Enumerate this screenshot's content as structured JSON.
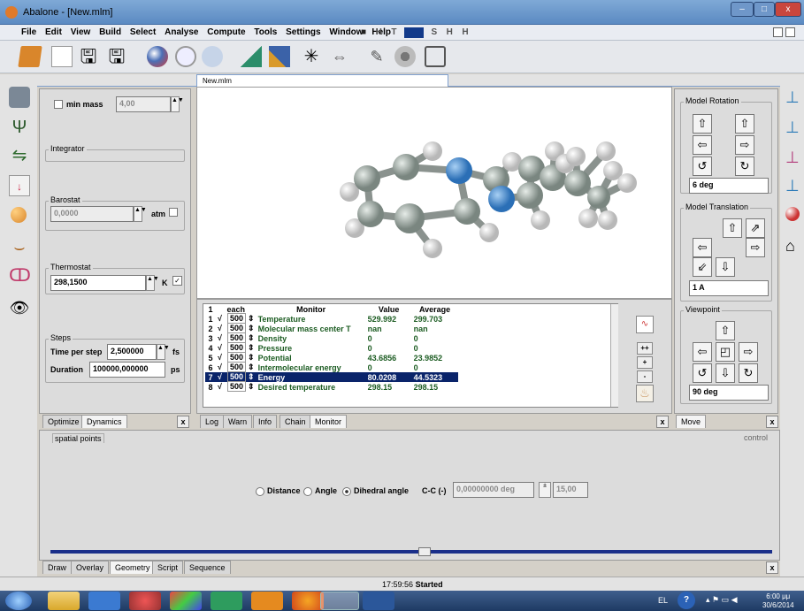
{
  "window": {
    "title": "Abalone - [New.mlm]",
    "minimize": "–",
    "maximize": "□",
    "close": "x"
  },
  "menu": [
    "File",
    "Edit",
    "View",
    "Build",
    "Select",
    "Analyse",
    "Compute",
    "Tools",
    "Settings",
    "Window",
    "Help"
  ],
  "player": [
    "■",
    "H",
    "T",
    "S",
    "H",
    "H"
  ],
  "document_tab": "New.mlm",
  "left_panel": {
    "min_mass_label": "min mass",
    "min_mass_value": "4,00",
    "integrator_label": "Integrator",
    "barostat_label": "Barostat",
    "barostat_value": "0,0000",
    "barostat_unit": "atm",
    "thermostat_label": "Thermostat",
    "thermostat_value": "298,1500",
    "thermostat_unit": "K",
    "thermostat_check": "✓",
    "steps_label": "Steps",
    "time_per_step_label": "Time per step",
    "time_per_step_value": "2,500000",
    "time_per_step_unit": "fs",
    "duration_label": "Duration",
    "duration_value": "100000,000000",
    "duration_unit": "ps",
    "tabs": [
      "Optimize",
      "Dynamics"
    ]
  },
  "monitor": {
    "headers": [
      "1",
      "each",
      "Monitor",
      "Value",
      "Average"
    ],
    "rows": [
      {
        "n": "1",
        "each": "500",
        "name": "Temperature",
        "value": "529.992",
        "avg": "299.703"
      },
      {
        "n": "2",
        "each": "500",
        "name": "Molecular mass center T",
        "value": "nan",
        "avg": "nan"
      },
      {
        "n": "3",
        "each": "500",
        "name": "Density",
        "value": "0",
        "avg": "0"
      },
      {
        "n": "4",
        "each": "500",
        "name": "Pressure",
        "value": "0",
        "avg": "0"
      },
      {
        "n": "5",
        "each": "500",
        "name": "Potential",
        "value": "43.6856",
        "avg": "23.9852"
      },
      {
        "n": "6",
        "each": "500",
        "name": "Intermolecular energy",
        "value": "0",
        "avg": "0"
      },
      {
        "n": "7",
        "each": "500",
        "name": "Energy",
        "value": "80.0208",
        "avg": "44.5323"
      },
      {
        "n": "8",
        "each": "500",
        "name": "Desired temperature",
        "value": "298.15",
        "avg": "298.15"
      }
    ],
    "side_buttons": [
      "++",
      "+",
      "-"
    ],
    "tabs": [
      "Log",
      "Warn",
      "Info",
      "Chain",
      "Monitor"
    ]
  },
  "right_panel": {
    "rotation_label": "Model Rotation",
    "rotation_value": "6 deg",
    "translation_label": "Model Translation",
    "translation_value": "1 A",
    "viewpoint_label": "Viewpoint",
    "viewpoint_value": "90 deg",
    "tabs": [
      "Move"
    ]
  },
  "bottom": {
    "spatial_points": "spatial points",
    "control": "control",
    "options": [
      "Distance",
      "Angle",
      "Dihedral angle"
    ],
    "selected_option": "Dihedral angle",
    "bond_label": "C-C (-)",
    "angle_value": "0,00000000 deg",
    "step_value": "15,00",
    "slider_fraction": 0.52,
    "tabs": [
      "Draw",
      "Overlay",
      "Geometry",
      "Script",
      "Sequence"
    ]
  },
  "status": {
    "time": "17:59:56",
    "text": "Started"
  },
  "taskbar": {
    "lang": "EL",
    "clock_time": "6:00 μμ",
    "clock_date": "30/6/2014"
  },
  "colors": {
    "carbon": "#9aa4a0",
    "nitrogen": "#4a8fd6",
    "hydrogen": "#f2f2f2",
    "selected_row": "#0a246a"
  }
}
